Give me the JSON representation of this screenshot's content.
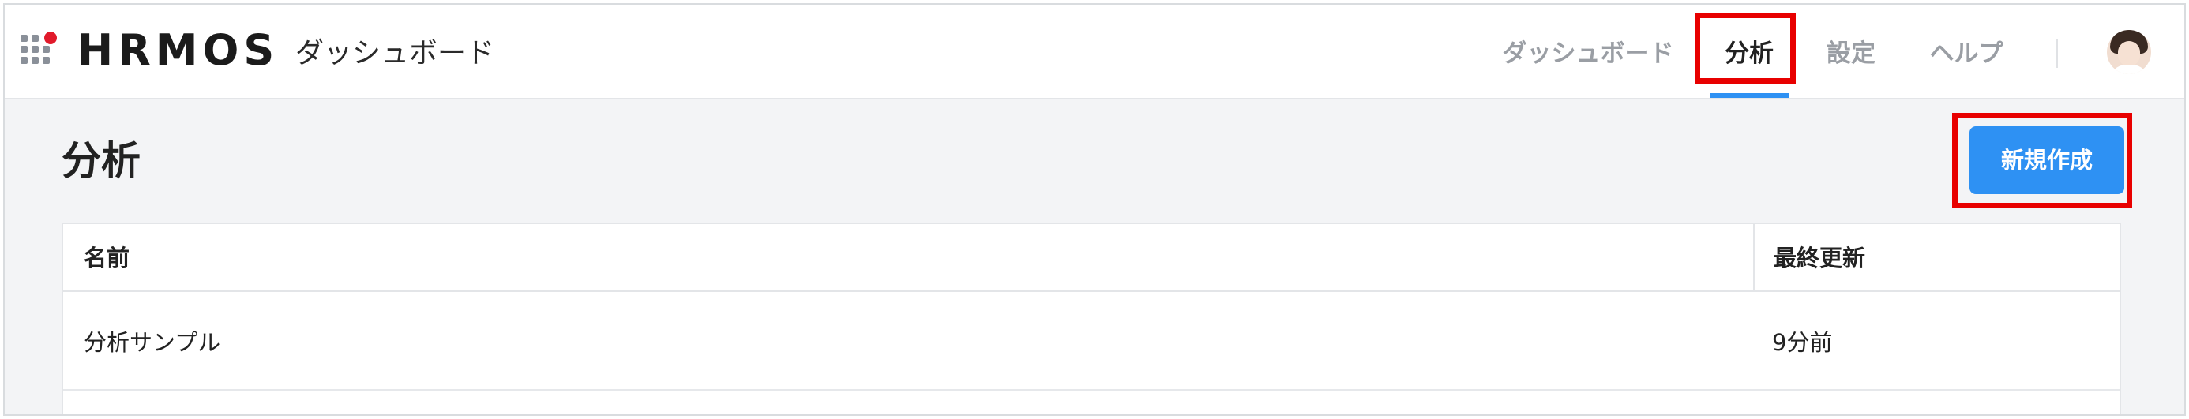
{
  "header": {
    "logo_text": "HRMOS",
    "product_name": "ダッシュボード",
    "nav": [
      {
        "label": "ダッシュボード",
        "active": false
      },
      {
        "label": "分析",
        "active": true
      },
      {
        "label": "設定",
        "active": false
      },
      {
        "label": "ヘルプ",
        "active": false
      }
    ],
    "accent_color": "#2e91f3",
    "logo_dot_color": "#e11a2b"
  },
  "main": {
    "title": "分析",
    "new_button_label": "新規作成",
    "table": {
      "columns": [
        "名前",
        "最終更新"
      ],
      "rows": [
        {
          "name": "分析サンプル",
          "updated": "9分前"
        }
      ]
    }
  },
  "annotations": {
    "highlight_color": "#e80000"
  }
}
